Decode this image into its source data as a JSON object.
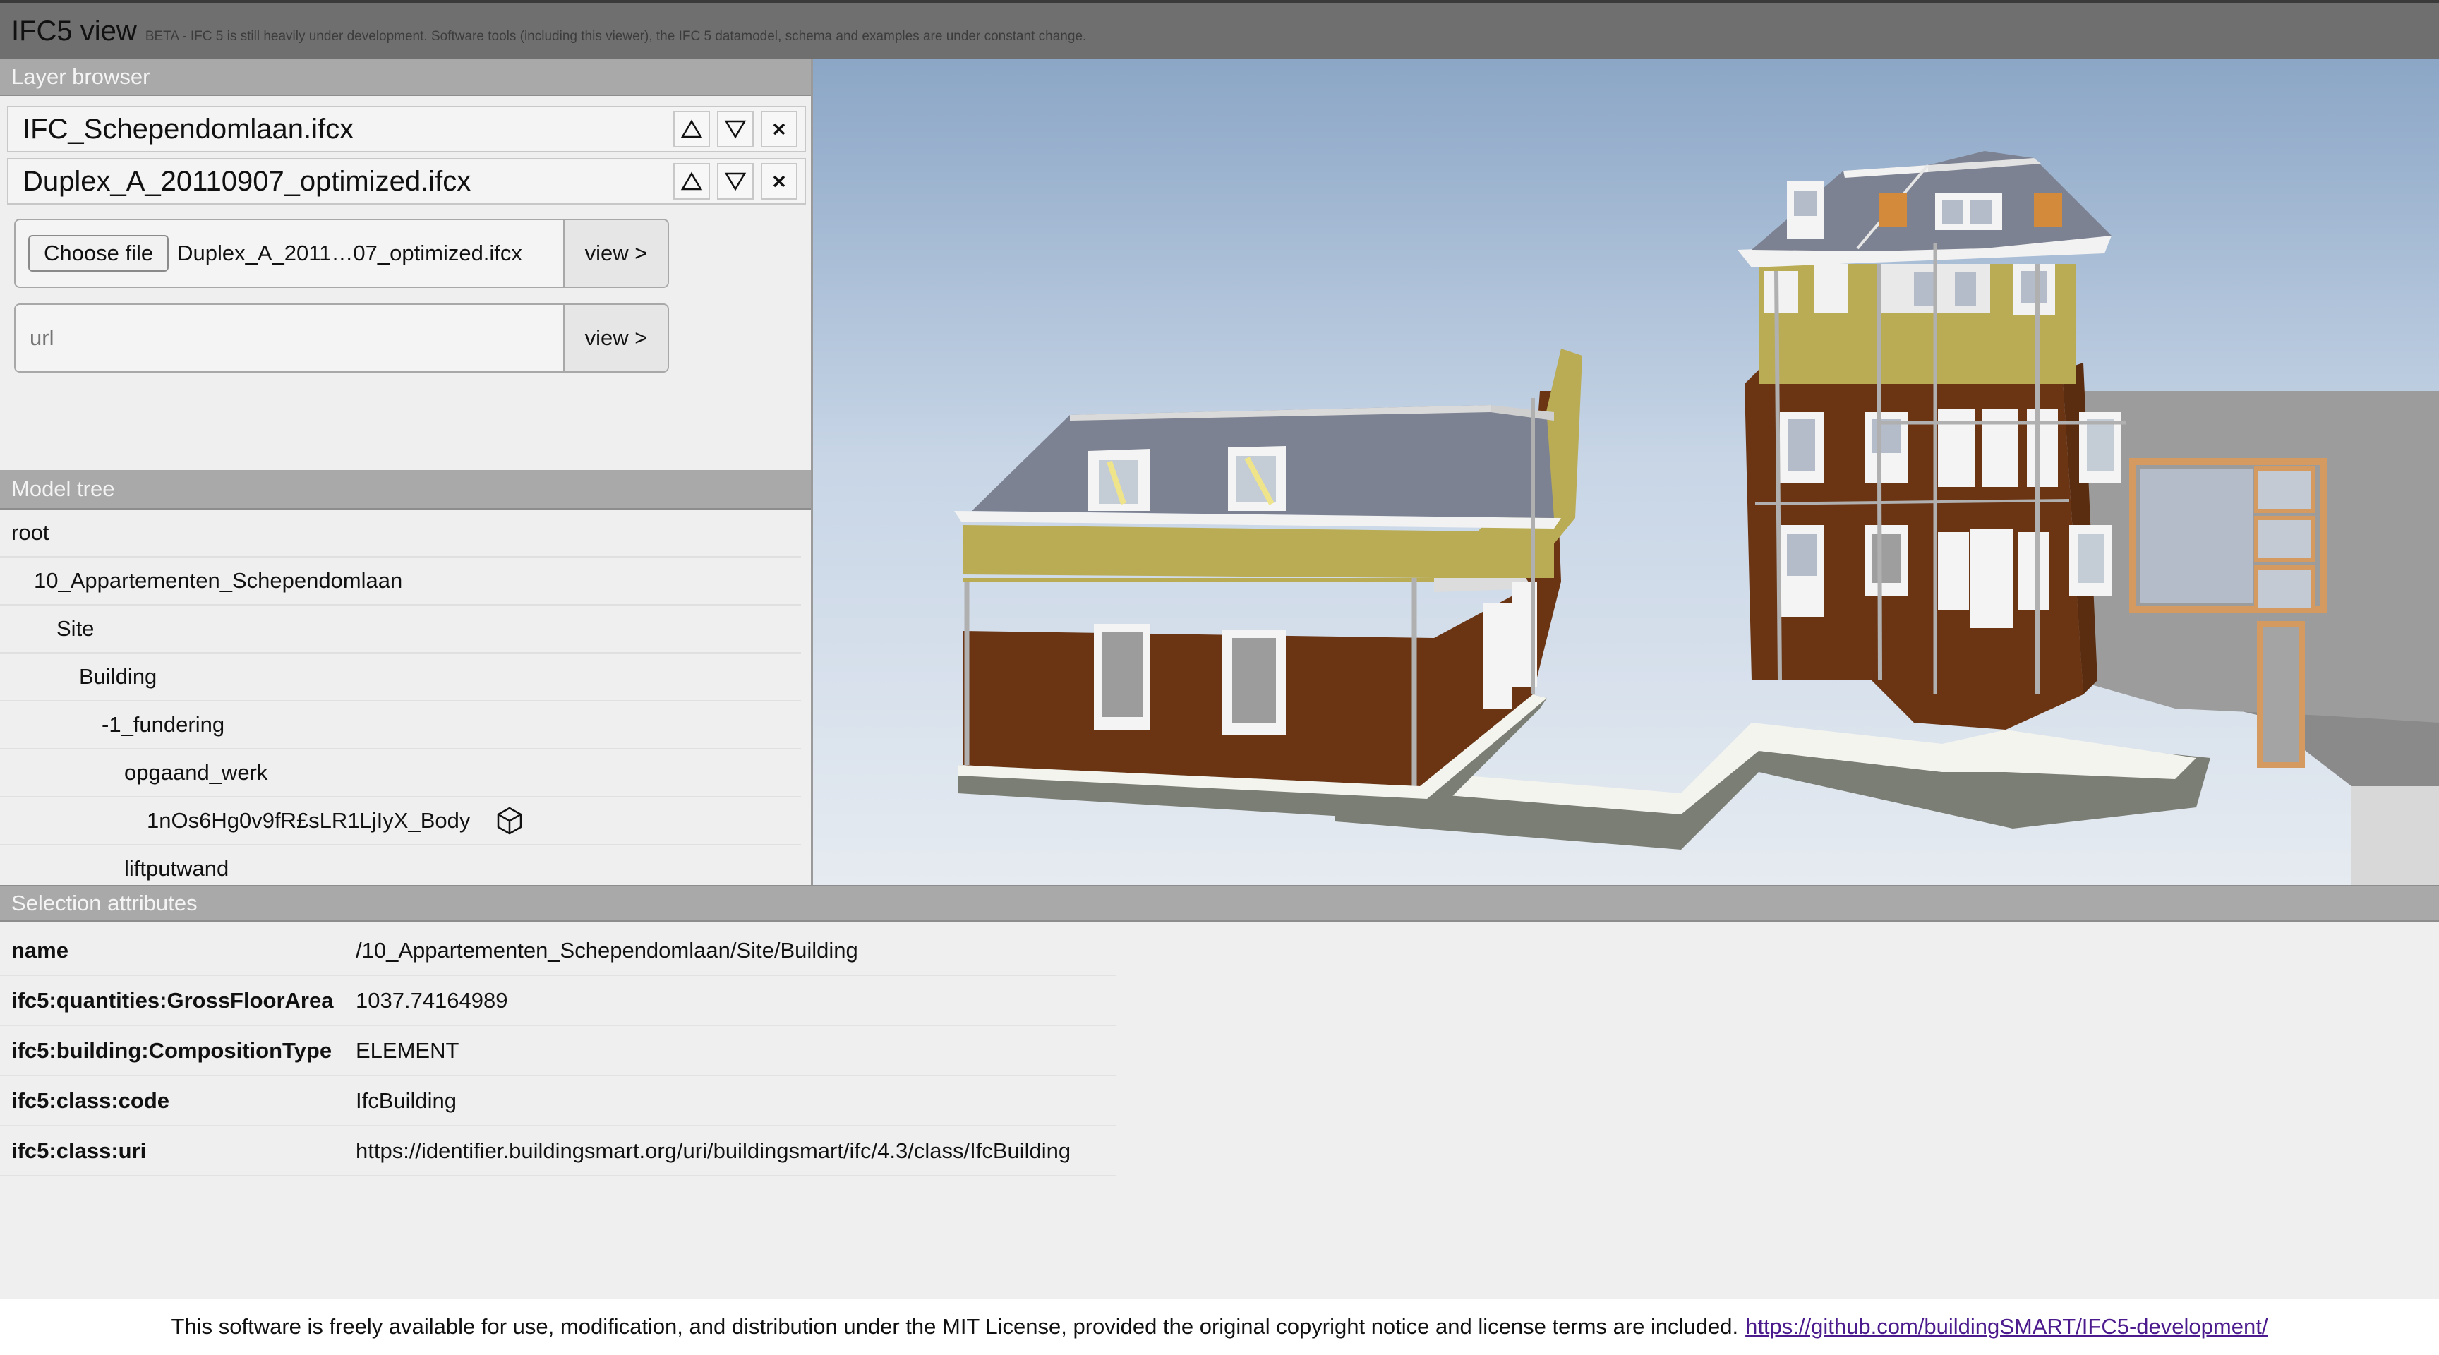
{
  "header": {
    "title": "IFC5 view",
    "beta_notice": "BETA - IFC 5 is still heavily under development. Software tools (including this viewer), the IFC 5 datamodel, schema and examples are under constant change."
  },
  "layer_browser": {
    "heading": "Layer browser",
    "layers": [
      {
        "name": "IFC_Schependomlaan.ifcx"
      },
      {
        "name": "Duplex_A_20110907_optimized.ifcx"
      }
    ],
    "file_input": {
      "choose_label": "Choose file",
      "file_name": "Duplex_A_2011…07_optimized.ifcx",
      "view_label": "view >"
    },
    "url_input": {
      "placeholder": "url",
      "view_label": "view >"
    }
  },
  "model_tree": {
    "heading": "Model tree",
    "nodes": [
      {
        "label": "root",
        "depth": 0
      },
      {
        "label": "10_Appartementen_Schependomlaan",
        "depth": 1
      },
      {
        "label": "Site",
        "depth": 2
      },
      {
        "label": "Building",
        "depth": 3
      },
      {
        "label": "-1_fundering",
        "depth": 4
      },
      {
        "label": "opgaand_werk",
        "depth": 5
      },
      {
        "label": "1nOs6Hg0v9fR£sLR1LjIyX_Body",
        "depth": 6,
        "icon": "cube-icon"
      },
      {
        "label": "liftputwand",
        "depth": 5
      }
    ]
  },
  "selection_attributes": {
    "heading": "Selection attributes",
    "rows": [
      {
        "key": "name",
        "value": "/10_Appartementen_Schependomlaan/Site/Building"
      },
      {
        "key": "ifc5:quantities:GrossFloorArea",
        "value": "1037.74164989"
      },
      {
        "key": "ifc5:building:CompositionType",
        "value": "ELEMENT"
      },
      {
        "key": "ifc5:class:code",
        "value": "IfcBuilding"
      },
      {
        "key": "ifc5:class:uri",
        "value": "https://identifier.buildingsmart.org/uri/buildingsmart/ifc/4.3/class/IfcBuilding"
      }
    ]
  },
  "footer": {
    "text": "This software is freely available for use, modification, and distribution under the MIT License, provided the original copyright notice and license terms are included.",
    "link": "https://github.com/buildingSMART/IFC5-development/"
  },
  "colors": {
    "header_bg": "#6f6f6f",
    "section_header_bg": "#a9a9a9",
    "panel_bg": "#efefef",
    "brick": "#6b3514",
    "roof": "#7d8292",
    "ochre": "#b9ac55",
    "link": "#4b1a8c"
  }
}
